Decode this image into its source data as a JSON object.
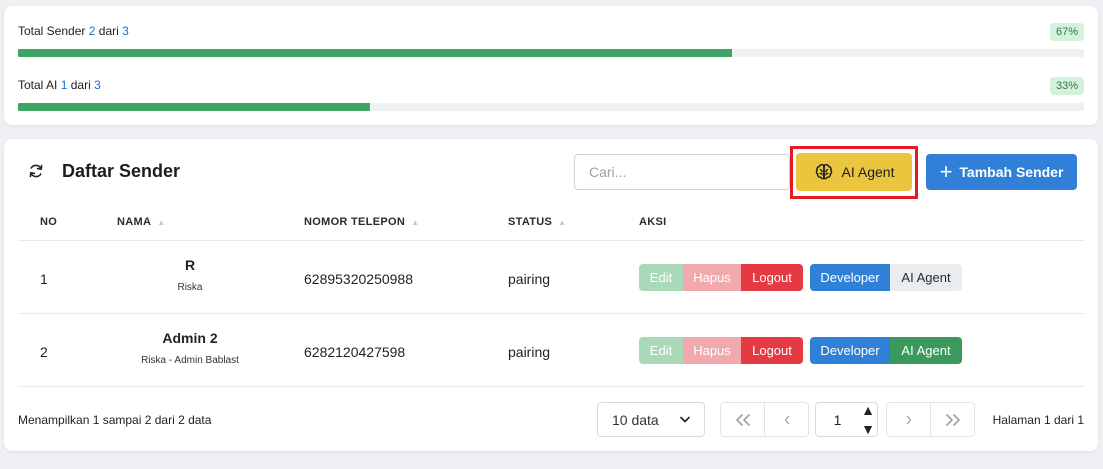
{
  "stats": [
    {
      "label_prefix": "Total Sender",
      "current": "2",
      "joiner": "dari",
      "total": "3",
      "percent_label": "67%",
      "progress": 0.67
    },
    {
      "label_prefix": "Total AI",
      "current": "1",
      "joiner": "dari",
      "total": "3",
      "percent_label": "33%",
      "progress": 0.33
    }
  ],
  "colors": {
    "progress": "#3ea663",
    "primary": "#2f80d6",
    "warning": "#ecc53e",
    "danger": "#e53a43",
    "success": "#3a9a5d",
    "highlight": "#e41b23"
  },
  "header": {
    "title": "Daftar Sender",
    "search_placeholder": "Cari...",
    "ai_agent_label": "AI Agent",
    "add_label": "Tambah Sender"
  },
  "table": {
    "columns": [
      "NO",
      "NAMA",
      "NOMOR TELEPON",
      "STATUS",
      "AKSI"
    ],
    "rows": [
      {
        "no": "1",
        "name": "R",
        "sub": "Riska",
        "phone": "62895320250988",
        "status": "pairing",
        "ai_active": false
      },
      {
        "no": "2",
        "name": "Admin 2",
        "sub": "Riska - Admin Bablast",
        "phone": "6282120427598",
        "status": "pairing",
        "ai_active": true
      }
    ],
    "actions": {
      "edit": "Edit",
      "hapus": "Hapus",
      "logout": "Logout",
      "developer": "Developer",
      "ai_agent": "AI Agent"
    }
  },
  "footer": {
    "summary": "Menampilkan 1 sampai 2 dari 2 data",
    "page_size": "10 data",
    "current_page": "1",
    "page_info": "Halaman 1 dari 1"
  },
  "icons": {
    "refresh": "refresh-icon",
    "brain": "brain-icon",
    "plus": "plus-icon",
    "chevron": "chevron-down-icon"
  }
}
